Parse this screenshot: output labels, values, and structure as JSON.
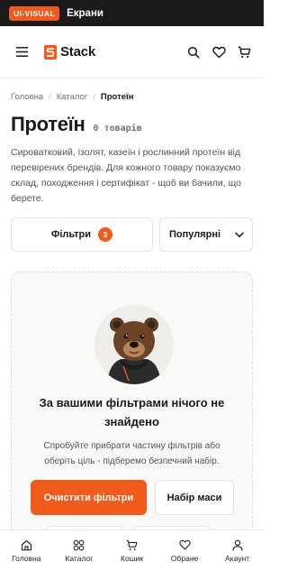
{
  "topbar": {
    "badge": "UI-VISUAL",
    "title": "Екрани"
  },
  "header": {
    "logo_text": "Stack",
    "icons": [
      "menu-icon",
      "search-icon",
      "heart-icon",
      "cart-icon"
    ]
  },
  "breadcrumb": {
    "items": [
      "Головна",
      "Каталог"
    ],
    "current": "Протеїн"
  },
  "page": {
    "title": "Протеїн",
    "count": "0 товарів",
    "description": "Сироватковий, ізолят, казеїн і рослинний протеїн від перевірених брендів. Для кожного товару показуємо склад, походження і сертифікат - щоб ви бачили, що берете."
  },
  "controls": {
    "filters_label": "Фільтри",
    "filters_count": "3",
    "sort_label": "Популярні"
  },
  "empty": {
    "title": "За вашими фільтрами нічого не знайдено",
    "text": "Спробуйте прибрати частину фільтрів або оберіть ціль - підберемо безпечний набір.",
    "primary": "Очистити фільтри",
    "secondary": "Набір маси"
  },
  "nav": {
    "home": "Головна",
    "catalog": "Каталог",
    "cart": "Кошик",
    "favorites": "Обране",
    "account": "Акаунт"
  },
  "colors": {
    "accent": "#f05a1a",
    "dark": "#1a1a1a"
  }
}
